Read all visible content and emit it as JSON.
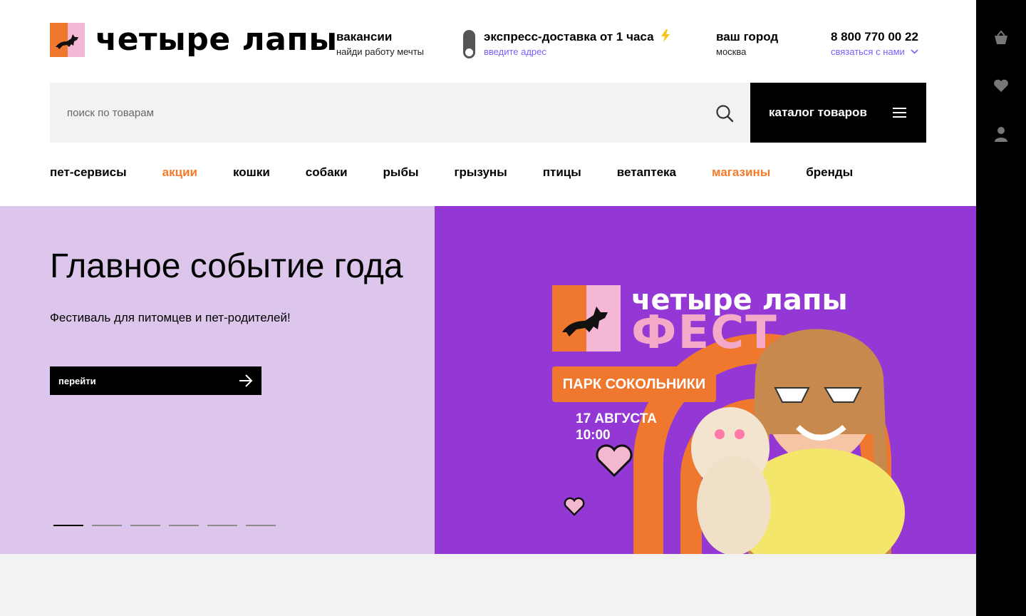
{
  "header": {
    "logo_text": "четыре лапы",
    "vacancies": {
      "title": "вакансии",
      "subtitle": "найди работу мечты"
    },
    "delivery": {
      "title": "экспресс-доставка от 1 часа",
      "link": "введите адрес"
    },
    "city": {
      "title": "ваш город",
      "value": "москва"
    },
    "contact": {
      "phone": "8 800 770 00 22",
      "link": "связаться с нами"
    }
  },
  "search": {
    "placeholder": "поиск по товарам"
  },
  "catalog": {
    "label": "каталог товаров"
  },
  "nav": {
    "items": [
      {
        "label": "пет-сервисы",
        "accent": false
      },
      {
        "label": "акции",
        "accent": true
      },
      {
        "label": "кошки",
        "accent": false
      },
      {
        "label": "собаки",
        "accent": false
      },
      {
        "label": "рыбы",
        "accent": false
      },
      {
        "label": "грызуны",
        "accent": false
      },
      {
        "label": "птицы",
        "accent": false
      },
      {
        "label": "ветаптека",
        "accent": false
      },
      {
        "label": "магазины",
        "accent": true
      },
      {
        "label": "бренды",
        "accent": false
      }
    ]
  },
  "hero": {
    "title": "Главное событие года",
    "subtitle": "Фестиваль для питомцев и пет-родителей!",
    "cta_label": "перейти",
    "slides_count": 6,
    "active_slide": 0,
    "banner": {
      "brand": "четыре лапы",
      "fest": "ФЕСТ",
      "place": "ПАРК СОКОЛЬНИКИ",
      "date": "17 АВГУСТА",
      "time": "10:00"
    }
  },
  "colors": {
    "accent_orange": "#f47a2a",
    "link_purple": "#7b5cff",
    "hero_left_bg": "#dcc6ec",
    "hero_right_bg": "#9338d4",
    "logo_orange": "#f0772e",
    "logo_pink": "#f4b8d6"
  },
  "rail_icons": [
    "cart-icon",
    "heart-icon",
    "user-icon"
  ]
}
